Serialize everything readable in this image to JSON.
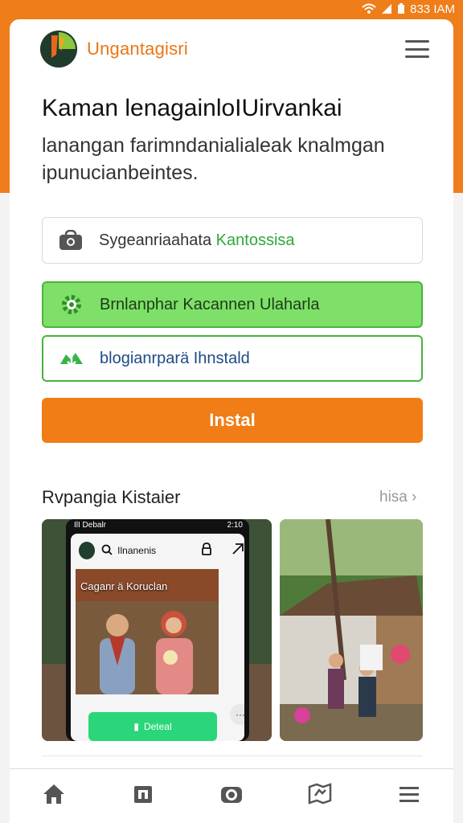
{
  "status_bar": {
    "time": "833 IAM"
  },
  "app": {
    "brand": "Ungantagisri"
  },
  "hero": {
    "title": "Kaman lenagainloIUirvankai",
    "subtitle": "lanangan farimndanialialeak knalmgan ipunucianbeintes."
  },
  "buttons": {
    "store_label_prefix": "Sygeanriaahata ",
    "store_label_highlight": "Kantossisa",
    "green_label": "Brnlanphar Kacannen Ulaharla",
    "outline_label": "blogianrparä Ihnstald",
    "install_label": "Instal"
  },
  "screenshots_section": {
    "title": "Rvpangia Kistaier",
    "see_all": "hisa ›",
    "phone_time": "2:10",
    "phone_operator": "IlI Debalr",
    "search_text": "Ilnanenis",
    "caption": "Caganr ä Koruclan",
    "install_button": "Deteal",
    "more_button": "···"
  },
  "colors": {
    "brand_orange": "#ee7d1a",
    "accent_green": "#49b33b",
    "green_fill": "#7ee068",
    "link_blue": "#1f4a86"
  },
  "icons": {
    "store": "bag-icon",
    "settings": "gear-icon",
    "install": "install-icon",
    "nav": [
      "home-icon",
      "store-icon",
      "camera-icon",
      "map-icon",
      "menu-icon"
    ]
  }
}
